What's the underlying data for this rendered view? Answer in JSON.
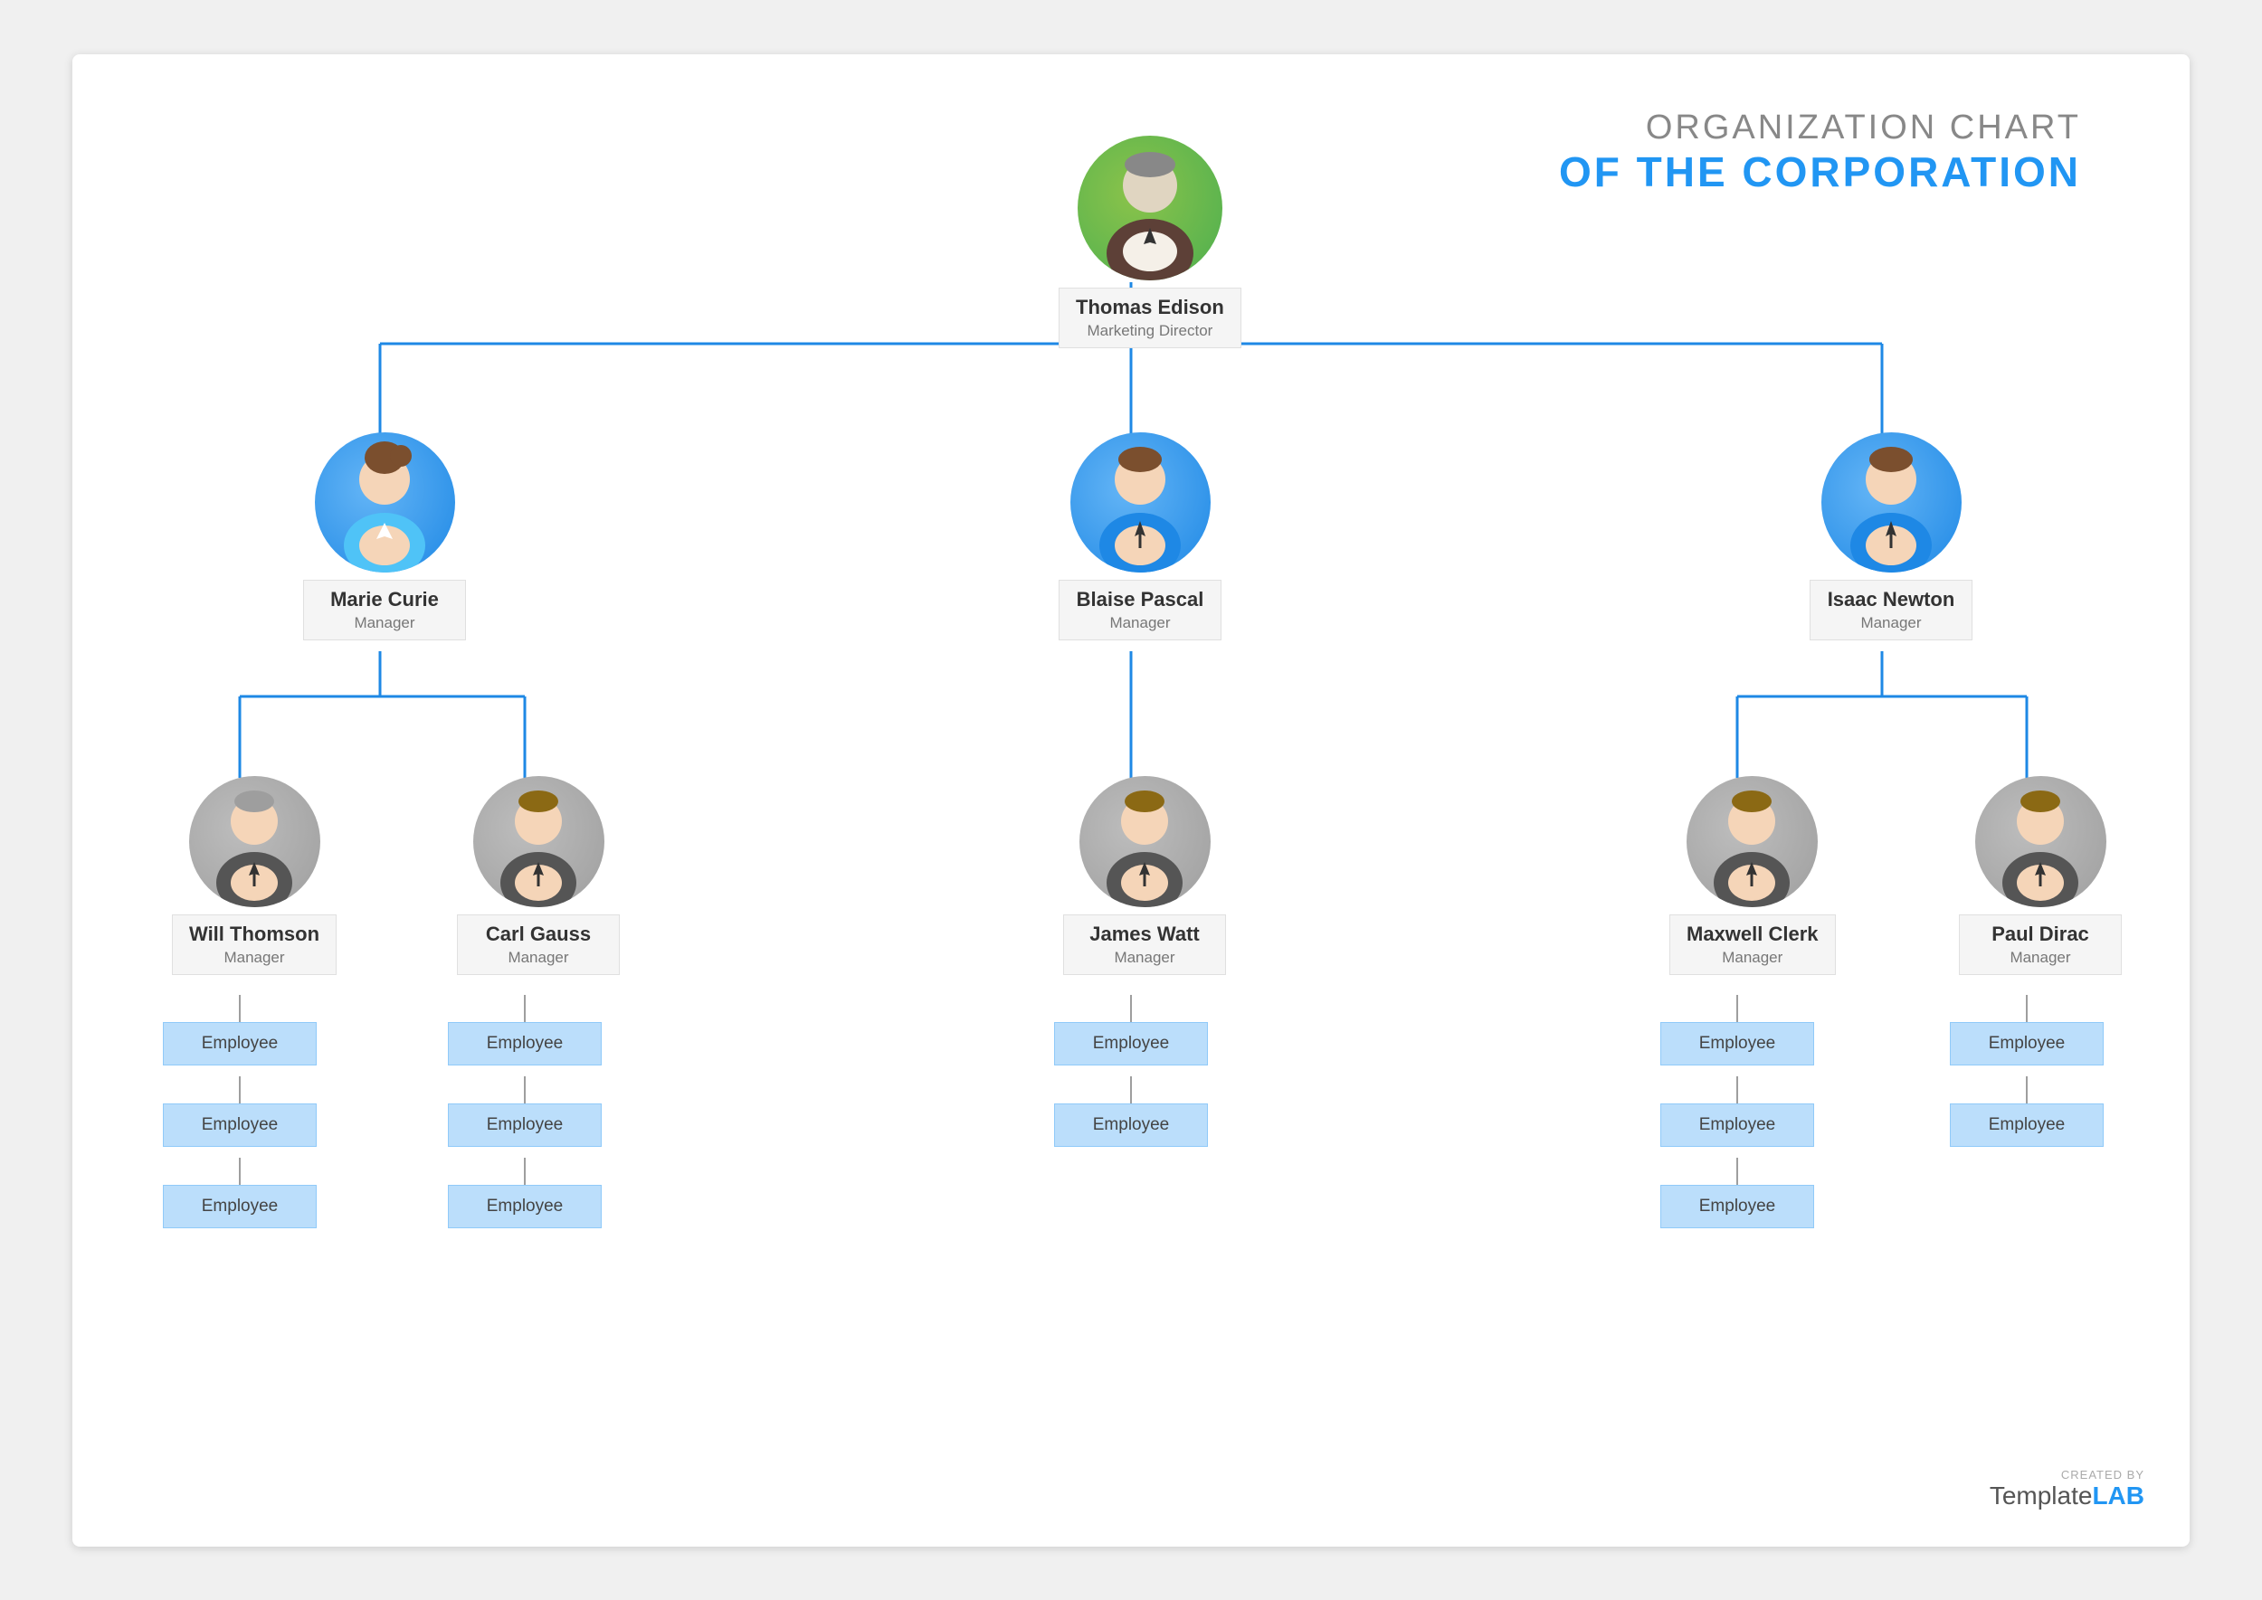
{
  "title": {
    "line1": "ORGANIZATION CHART",
    "line2": "OF THE CORPORATION"
  },
  "watermark": {
    "created_by": "CREATED BY",
    "brand_light": "Template",
    "brand_bold": "LAB"
  },
  "people": {
    "ceo": {
      "name": "Thomas Edison",
      "role": "Marketing Director"
    },
    "manager1": {
      "name": "Marie Curie",
      "role": "Manager"
    },
    "manager2": {
      "name": "Blaise Pascal",
      "role": "Manager"
    },
    "manager3": {
      "name": "Isaac Newton",
      "role": "Manager"
    },
    "sub1": {
      "name": "Will Thomson",
      "role": "Manager"
    },
    "sub2": {
      "name": "Carl Gauss",
      "role": "Manager"
    },
    "sub3": {
      "name": "James Watt",
      "role": "Manager"
    },
    "sub4": {
      "name": "Maxwell Clerk",
      "role": "Manager"
    },
    "sub5": {
      "name": "Paul Dirac",
      "role": "Manager"
    }
  },
  "employee_label": "Employee"
}
